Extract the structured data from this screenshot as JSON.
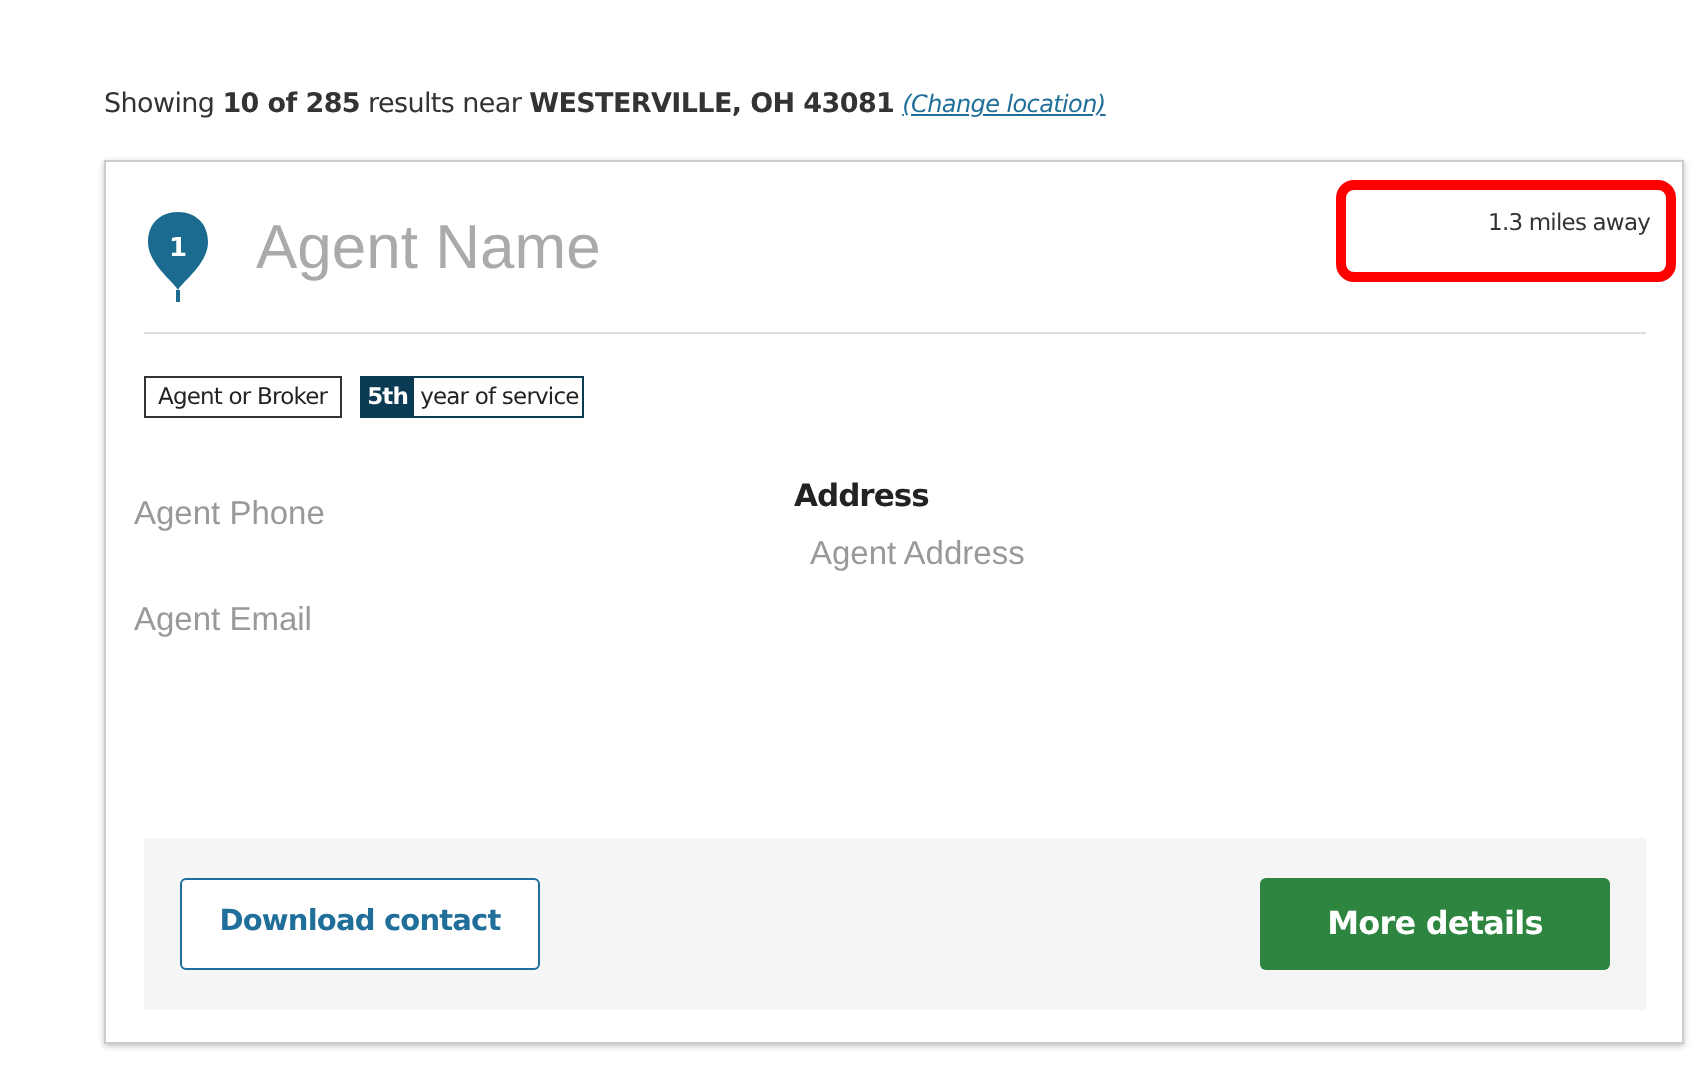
{
  "summary": {
    "text": "Showing **10 of 285** results near **WESTERVILLE, OH 43081**",
    "link": "(Change location)"
  },
  "agent": {
    "number": "1",
    "name": "Agent Name",
    "distance": "1.3 miles away",
    "distance_highlighted": true,
    "badges": [
      {
        "kind": "plain",
        "text": "Agent or Broker"
      },
      {
        "kind": "split",
        "lead": "5th",
        "text": "year of service"
      }
    ],
    "phone": "Agent Phone",
    "email": "Agent Email",
    "address_label": "Address",
    "address": "Agent Address"
  },
  "buttons": [
    {
      "kind": "outline",
      "label": "Download contact"
    },
    {
      "kind": "primary",
      "label": "More details"
    }
  ]
}
